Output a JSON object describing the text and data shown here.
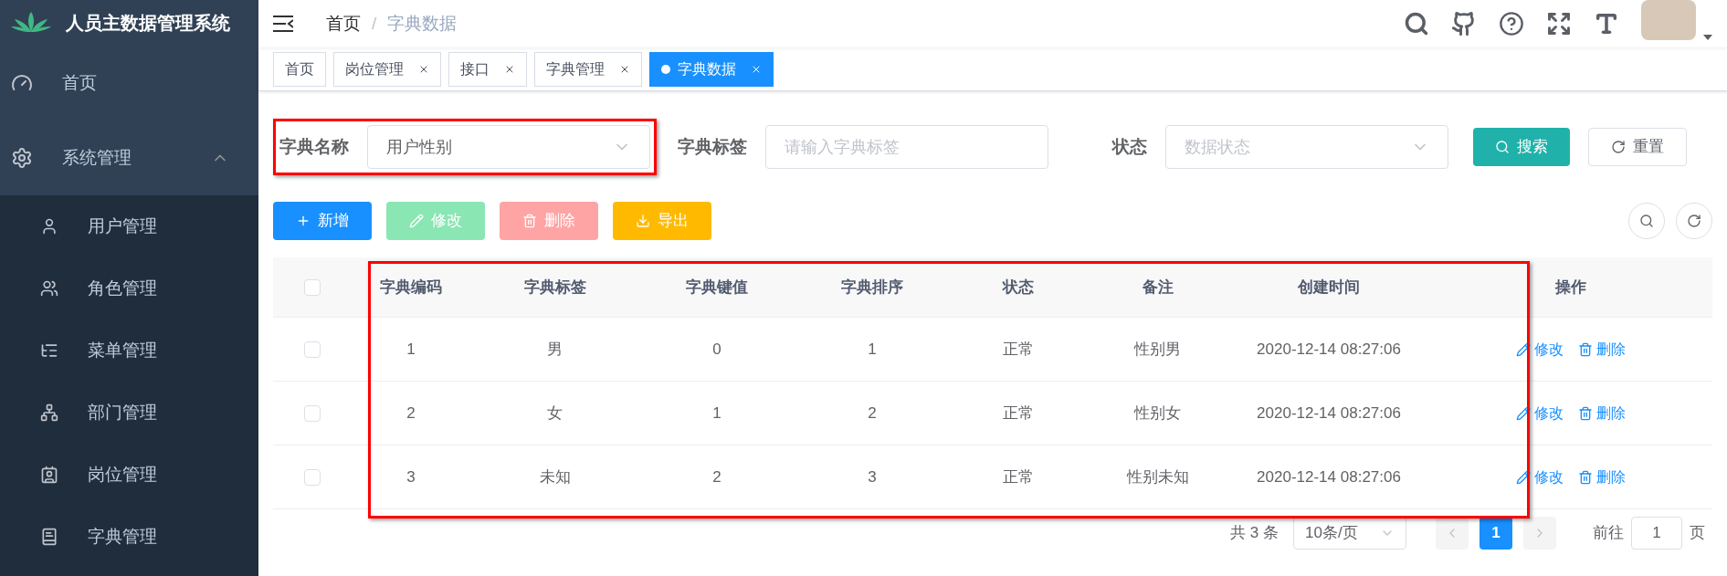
{
  "sidebar": {
    "title": "人员主数据管理系统",
    "items": [
      {
        "label": "首页"
      },
      {
        "label": "系统管理",
        "expanded": true,
        "children": [
          {
            "label": "用户管理"
          },
          {
            "label": "角色管理"
          },
          {
            "label": "菜单管理"
          },
          {
            "label": "部门管理"
          },
          {
            "label": "岗位管理"
          },
          {
            "label": "字典管理"
          }
        ]
      }
    ]
  },
  "breadcrumb_separator": "/",
  "breadcrumb": [
    {
      "label": "首页",
      "selected": false
    },
    {
      "label": "字典数据",
      "selected": true
    }
  ],
  "tags": [
    {
      "label": "首页",
      "selected": false,
      "closable": false
    },
    {
      "label": "岗位管理",
      "selected": false,
      "closable": true
    },
    {
      "label": "接口",
      "selected": false,
      "closable": true
    },
    {
      "label": "字典管理",
      "selected": false,
      "closable": true
    },
    {
      "label": "字典数据",
      "selected": true,
      "closable": true
    }
  ],
  "filters": [
    {
      "label": "字典名称",
      "kind": "select",
      "value": "用户性别",
      "highlighted": true
    },
    {
      "label": "字典标签",
      "kind": "input",
      "placeholder": "请输入字典标签",
      "highlighted": false
    },
    {
      "label": "状态",
      "kind": "select",
      "placeholder": "数据状态",
      "highlighted": false
    }
  ],
  "filter_buttons": [
    {
      "label": "搜索",
      "kind": "search"
    },
    {
      "label": "重置",
      "kind": "reset"
    }
  ],
  "toolbar": [
    {
      "label": "新增",
      "kind": "add",
      "disabled": false
    },
    {
      "label": "修改",
      "kind": "edit",
      "disabled": true
    },
    {
      "label": "删除",
      "kind": "delete",
      "disabled": true
    },
    {
      "label": "导出",
      "kind": "export",
      "disabled": false
    }
  ],
  "table": {
    "highlighted": true,
    "all_checked": false,
    "columns": [
      "字典编码",
      "字典标签",
      "字典键值",
      "字典排序",
      "状态",
      "备注",
      "创建时间",
      "操作"
    ],
    "rows": [
      {
        "checked": false,
        "cells": [
          "1",
          "男",
          "0",
          "1",
          "正常",
          "性别男",
          "2020-12-14 08:27:06"
        ],
        "actions": [
          "修改",
          "删除"
        ]
      },
      {
        "checked": false,
        "cells": [
          "2",
          "女",
          "1",
          "2",
          "正常",
          "性别女",
          "2020-12-14 08:27:06"
        ],
        "actions": [
          "修改",
          "删除"
        ]
      },
      {
        "checked": false,
        "cells": [
          "3",
          "未知",
          "2",
          "3",
          "正常",
          "性别未知",
          "2020-12-14 08:27:06"
        ],
        "actions": [
          "修改",
          "删除"
        ]
      }
    ]
  },
  "pagination": {
    "total": "共 3 条",
    "page_size": "10条/页",
    "pages": [
      {
        "label": "1",
        "selected": true
      }
    ],
    "goto_label": "前往",
    "goto_value": "1",
    "goto_suffix": "页"
  }
}
